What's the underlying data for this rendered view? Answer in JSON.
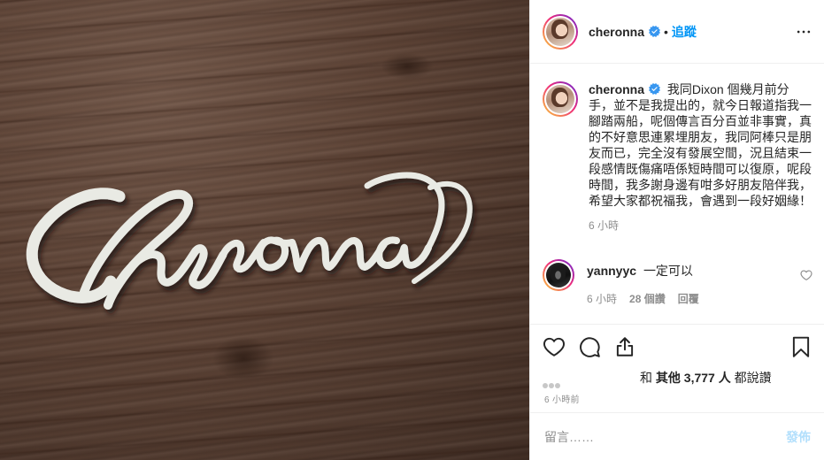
{
  "post": {
    "username": "cheronna",
    "follow_label": "追蹤",
    "caption": "我同Dixon 個幾月前分手，並不是我提出的，就今日報道指我一腳踏兩船，呢個傳言百分百並非事實，真的不好意思連累埋朋友，我同阿棒只是朋友而已，完全沒有發展空間，況且結束一段感情既傷痛唔係短時間可以復原，呢段時間，我多謝身邊有咁多好朋友陪伴我，希望大家都祝福我，會遇到一段好姻緣！",
    "caption_time": "6 小時",
    "photo_text": "cheronna"
  },
  "comments": [
    {
      "username": "yannyyc",
      "text": "一定可以",
      "time": "6 小時",
      "likes": "28 個讚",
      "reply": "回覆"
    }
  ],
  "likes_line": {
    "prefix": "和",
    "others_label": "其他 3,777 人",
    "suffix": "都說讚"
  },
  "post_time": "6 小時前",
  "comment_box": {
    "placeholder": "留言……",
    "post_label": "發佈"
  },
  "icons": {
    "verified": "verified-badge-icon",
    "more": "more-options-icon",
    "like": "heart-icon",
    "comment": "comment-icon",
    "share": "share-icon",
    "save": "bookmark-icon"
  },
  "colors": {
    "accent": "#0095f6",
    "post_disabled": "#b2dffc",
    "muted": "#8e8e8e",
    "text": "#262626"
  }
}
